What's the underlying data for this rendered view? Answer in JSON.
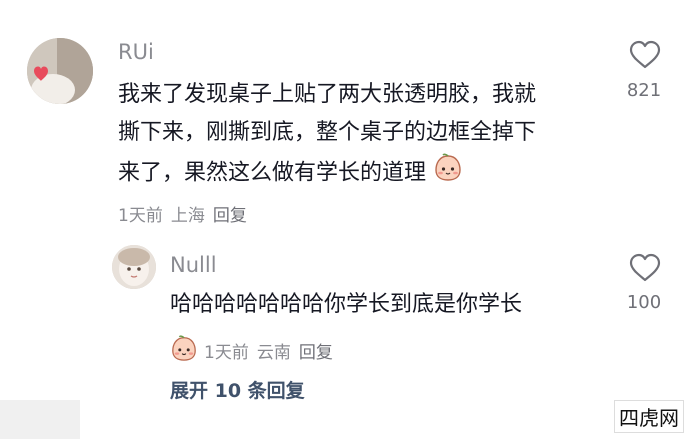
{
  "comment": {
    "username": "RUi",
    "text_lines": [
      "我来了发现桌子上贴了两大张透明胶，我就",
      "撕下来，刚撕到底，整个桌子的边框全掉下",
      "来了，果然这么做有学长的道理"
    ],
    "time": "1天前",
    "location": "上海",
    "reply_label": "回复",
    "likes": "821",
    "icons": {
      "like": "heart-outline-icon",
      "emoji": "peach-face-emoji-icon"
    }
  },
  "reply": {
    "username": "Nulll",
    "text": "哈哈哈哈哈哈哈你学长到底是你学长",
    "time": "1天前",
    "location": "云南",
    "reply_label": "回复",
    "likes": "100",
    "icons": {
      "like": "heart-outline-icon",
      "emoji": "peach-face-emoji-icon"
    }
  },
  "expand_label": "展开 10 条回复",
  "watermark": "四虎网",
  "colors": {
    "text": "#161823",
    "muted": "#8a8b91",
    "link": "#40526b"
  }
}
